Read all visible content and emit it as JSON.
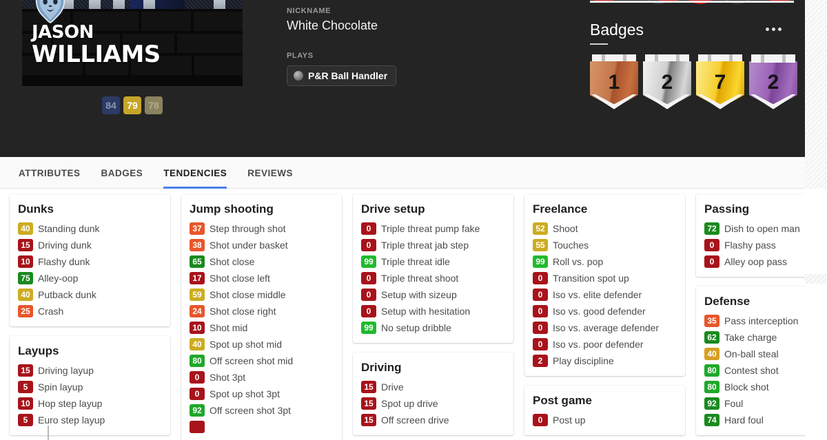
{
  "player": {
    "first_name": "JASON",
    "last_name": "WILLIAMS",
    "team_logo_icon": "grizzlies-bear-logo-icon",
    "ratings": [
      {
        "value": "84",
        "style": "r1"
      },
      {
        "value": "79",
        "style": "r2"
      },
      {
        "value": "78",
        "style": "r3"
      }
    ]
  },
  "info": {
    "nickname_label": "NICKNAME",
    "nickname": "White Chocolate",
    "plays_label": "PLAYS",
    "play_badge": "P&R Ball Handler",
    "play_badge_icon": "silver-ball-icon"
  },
  "badges_panel": {
    "title": "Badges",
    "more_icon": "ellipsis-icon",
    "shields": [
      {
        "count": "1",
        "tier": "bronze",
        "color": "#c3764a"
      },
      {
        "count": "2",
        "tier": "silver",
        "color": "#c9c9c9"
      },
      {
        "count": "7",
        "tier": "gold",
        "color": "#f0c418"
      },
      {
        "count": "2",
        "tier": "hall-of-fame",
        "color": "#9b62b8"
      }
    ]
  },
  "tabs": [
    {
      "label": "ATTRIBUTES",
      "active": false
    },
    {
      "label": "BADGES",
      "active": false
    },
    {
      "label": "TENDENCIES",
      "active": true
    },
    {
      "label": "REVIEWS",
      "active": false
    }
  ],
  "accent_color": "#4a7ff0",
  "columns": [
    {
      "cards": [
        {
          "title": "Dunks",
          "rows": [
            {
              "value": "40",
              "label": "Standing dunk",
              "color": "#ccac21"
            },
            {
              "value": "15",
              "label": "Driving dunk",
              "color": "#a8131b"
            },
            {
              "value": "10",
              "label": "Flashy dunk",
              "color": "#a8131b"
            },
            {
              "value": "75",
              "label": "Alley-oop",
              "color": "#1a8a1f"
            },
            {
              "value": "40",
              "label": "Putback dunk",
              "color": "#ccac21"
            },
            {
              "value": "25",
              "label": "Crash",
              "color": "#e8562a"
            }
          ]
        },
        {
          "title": "Layups",
          "rows": [
            {
              "value": "15",
              "label": "Driving layup",
              "color": "#a8131b"
            },
            {
              "value": "5",
              "label": "Spin layup",
              "color": "#a8131b"
            },
            {
              "value": "10",
              "label": "Hop step layup",
              "color": "#a8131b"
            },
            {
              "value": "5",
              "label": "Euro step layup",
              "color": "#a8131b"
            }
          ]
        }
      ]
    },
    {
      "cards": [
        {
          "title": "Jump shooting",
          "rows": [
            {
              "value": "37",
              "label": "Step through shot",
              "color": "#e8562a"
            },
            {
              "value": "38",
              "label": "Shot under basket",
              "color": "#e8562a"
            },
            {
              "value": "65",
              "label": "Shot close",
              "color": "#1a8a1f"
            },
            {
              "value": "17",
              "label": "Shot close left",
              "color": "#a8131b"
            },
            {
              "value": "59",
              "label": "Shot close middle",
              "color": "#ccac21"
            },
            {
              "value": "24",
              "label": "Shot close right",
              "color": "#e8562a"
            },
            {
              "value": "10",
              "label": "Shot mid",
              "color": "#a8131b"
            },
            {
              "value": "40",
              "label": "Spot up shot mid",
              "color": "#ccac21"
            },
            {
              "value": "80",
              "label": "Off screen shot mid",
              "color": "#1fa82a"
            },
            {
              "value": "0",
              "label": "Shot 3pt",
              "color": "#a8131b"
            },
            {
              "value": "0",
              "label": "Spot up shot 3pt",
              "color": "#a8131b"
            },
            {
              "value": "92",
              "label": "Off screen shot 3pt",
              "color": "#1fa82a"
            },
            {
              "value": "",
              "label": "",
              "color": "#a8131b"
            }
          ]
        }
      ]
    },
    {
      "cards": [
        {
          "title": "Drive setup",
          "rows": [
            {
              "value": "0",
              "label": "Triple threat pump fake",
              "color": "#a8131b"
            },
            {
              "value": "0",
              "label": "Triple threat jab step",
              "color": "#a8131b"
            },
            {
              "value": "99",
              "label": "Triple threat idle",
              "color": "#22b92e"
            },
            {
              "value": "0",
              "label": "Triple threat shoot",
              "color": "#a8131b"
            },
            {
              "value": "0",
              "label": "Setup with sizeup",
              "color": "#a8131b"
            },
            {
              "value": "0",
              "label": "Setup with hesitation",
              "color": "#a8131b"
            },
            {
              "value": "99",
              "label": "No setup dribble",
              "color": "#22b92e"
            }
          ]
        },
        {
          "title": "Driving",
          "rows": [
            {
              "value": "15",
              "label": "Drive",
              "color": "#a8131b"
            },
            {
              "value": "15",
              "label": "Spot up drive",
              "color": "#a8131b"
            },
            {
              "value": "15",
              "label": "Off screen drive",
              "color": "#a8131b"
            }
          ]
        }
      ]
    },
    {
      "cards": [
        {
          "title": "Freelance",
          "rows": [
            {
              "value": "52",
              "label": "Shoot",
              "color": "#ccac21"
            },
            {
              "value": "55",
              "label": "Touches",
              "color": "#ccac21"
            },
            {
              "value": "99",
              "label": "Roll vs. pop",
              "color": "#22b92e"
            },
            {
              "value": "0",
              "label": "Transition spot up",
              "color": "#a8131b"
            },
            {
              "value": "0",
              "label": "Iso vs. elite defender",
              "color": "#a8131b"
            },
            {
              "value": "0",
              "label": "Iso vs. good defender",
              "color": "#a8131b"
            },
            {
              "value": "0",
              "label": "Iso vs. average defender",
              "color": "#a8131b"
            },
            {
              "value": "0",
              "label": "Iso vs. poor defender",
              "color": "#a8131b"
            },
            {
              "value": "2",
              "label": "Play discipline",
              "color": "#a8131b"
            }
          ]
        },
        {
          "title": "Post game",
          "rows": [
            {
              "value": "0",
              "label": "Post up",
              "color": "#a8131b"
            }
          ]
        }
      ]
    },
    {
      "cards": [
        {
          "title": "Passing",
          "rows": [
            {
              "value": "72",
              "label": "Dish to open man",
              "color": "#1a8a1f"
            },
            {
              "value": "0",
              "label": "Flashy pass",
              "color": "#a8131b"
            },
            {
              "value": "0",
              "label": "Alley oop pass",
              "color": "#a8131b"
            }
          ]
        },
        {
          "title": "Defense",
          "rows": [
            {
              "value": "35",
              "label": "Pass interception",
              "color": "#e8562a"
            },
            {
              "value": "62",
              "label": "Take charge",
              "color": "#1a8a1f"
            },
            {
              "value": "40",
              "label": "On-ball steal",
              "color": "#d6a020"
            },
            {
              "value": "80",
              "label": "Contest shot",
              "color": "#1fa82a"
            },
            {
              "value": "80",
              "label": "Block shot",
              "color": "#1fa82a"
            },
            {
              "value": "92",
              "label": "Foul",
              "color": "#1a8a1f"
            },
            {
              "value": "74",
              "label": "Hard foul",
              "color": "#1a8a1f"
            }
          ]
        }
      ]
    }
  ]
}
